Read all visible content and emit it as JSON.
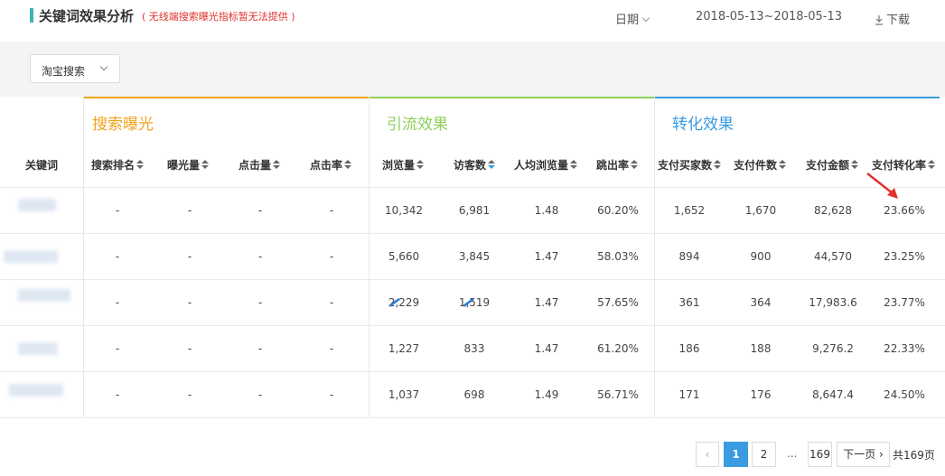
{
  "header": {
    "title": "关键词效果分析",
    "note": "( 无线端搜索曝光指标暂无法提供 )",
    "date_type_label": "日期",
    "date_range": "2018-05-13~2018-05-13",
    "download_label": "下载"
  },
  "filter": {
    "selected": "淘宝搜索"
  },
  "groups": {
    "search": {
      "label": "搜索曝光",
      "color": "#f0a41e"
    },
    "traffic": {
      "label": "引流效果",
      "color": "#8fcf5a"
    },
    "conversion": {
      "label": "转化效果",
      "color": "#3a9be0"
    }
  },
  "columns": {
    "keyword": "关键词",
    "search_rank": "搜索排名",
    "impressions": "曝光量",
    "clicks": "点击量",
    "ctr": "点击率",
    "pageviews": "浏览量",
    "visitors": "访客数",
    "pv_per_visitor": "人均浏览量",
    "bounce_rate": "跳出率",
    "buyers": "支付买家数",
    "items": "支付件数",
    "amount": "支付金额",
    "conv_rate": "支付转化率"
  },
  "rows": [
    {
      "search_rank": "-",
      "impressions": "-",
      "clicks": "-",
      "ctr": "-",
      "pageviews": "10,342",
      "visitors": "6,981",
      "pv_per_visitor": "1.48",
      "bounce_rate": "60.20%",
      "buyers": "1,652",
      "items": "1,670",
      "amount": "82,628",
      "conv_rate": "23.66%"
    },
    {
      "search_rank": "-",
      "impressions": "-",
      "clicks": "-",
      "ctr": "-",
      "pageviews": "5,660",
      "visitors": "3,845",
      "pv_per_visitor": "1.47",
      "bounce_rate": "58.03%",
      "buyers": "894",
      "items": "900",
      "amount": "44,570",
      "conv_rate": "23.25%"
    },
    {
      "search_rank": "-",
      "impressions": "-",
      "clicks": "-",
      "ctr": "-",
      "pageviews": "2,229",
      "visitors": "1,519",
      "pv_per_visitor": "1.47",
      "bounce_rate": "57.65%",
      "buyers": "361",
      "items": "364",
      "amount": "17,983.6",
      "conv_rate": "23.77%"
    },
    {
      "search_rank": "-",
      "impressions": "-",
      "clicks": "-",
      "ctr": "-",
      "pageviews": "1,227",
      "visitors": "833",
      "pv_per_visitor": "1.47",
      "bounce_rate": "61.20%",
      "buyers": "186",
      "items": "188",
      "amount": "9,276.2",
      "conv_rate": "22.33%"
    },
    {
      "search_rank": "-",
      "impressions": "-",
      "clicks": "-",
      "ctr": "-",
      "pageviews": "1,037",
      "visitors": "698",
      "pv_per_visitor": "1.49",
      "bounce_rate": "56.71%",
      "buyers": "171",
      "items": "176",
      "amount": "8,647.4",
      "conv_rate": "24.50%"
    }
  ],
  "pagination": {
    "prev": "‹",
    "pages": [
      "1",
      "2"
    ],
    "ellipsis": "...",
    "last_page": "169",
    "next_label": "下一页 ›",
    "total_label": "共169页"
  },
  "colors": {
    "accent": "#3a9be0",
    "title_bar": "#3bb4b5",
    "note": "#e0322e",
    "arrow": "#e0322e"
  }
}
